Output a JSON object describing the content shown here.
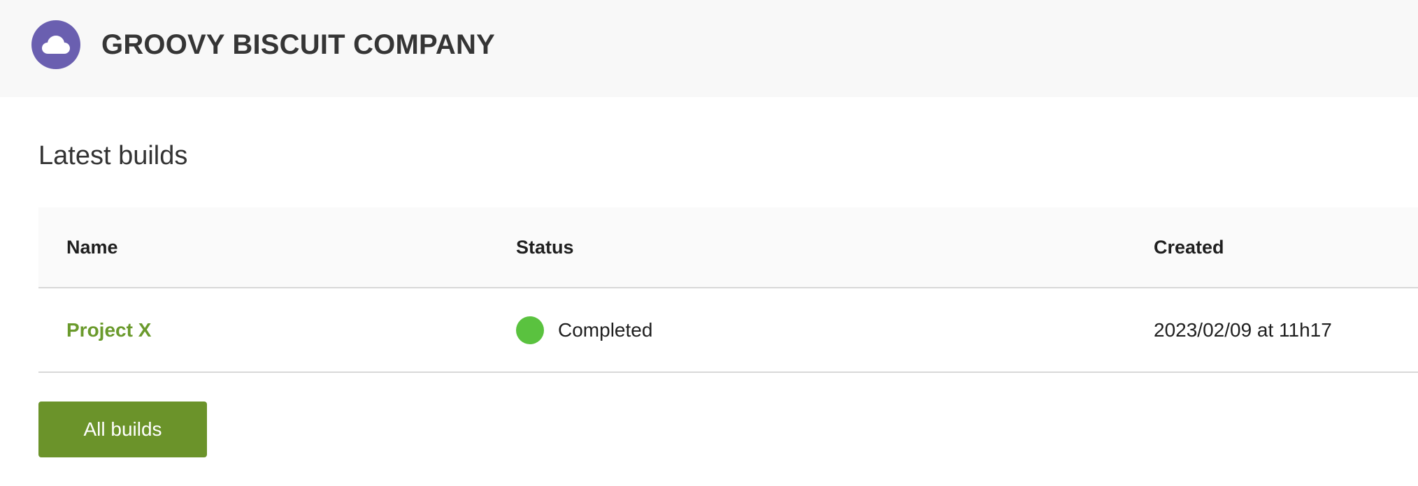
{
  "header": {
    "company_name": "GROOVY BISCUIT COMPANY",
    "logo_icon": "cloud-icon",
    "logo_color": "#6a5fb0"
  },
  "section": {
    "title": "Latest builds"
  },
  "table": {
    "columns": [
      "Name",
      "Status",
      "Created"
    ],
    "rows": [
      {
        "name": "Project X",
        "status": "Completed",
        "status_color": "#5ac23f",
        "created": "2023/02/09 at 11h17"
      }
    ]
  },
  "actions": {
    "all_builds_label": "All builds",
    "accent_color": "#6b932a"
  }
}
